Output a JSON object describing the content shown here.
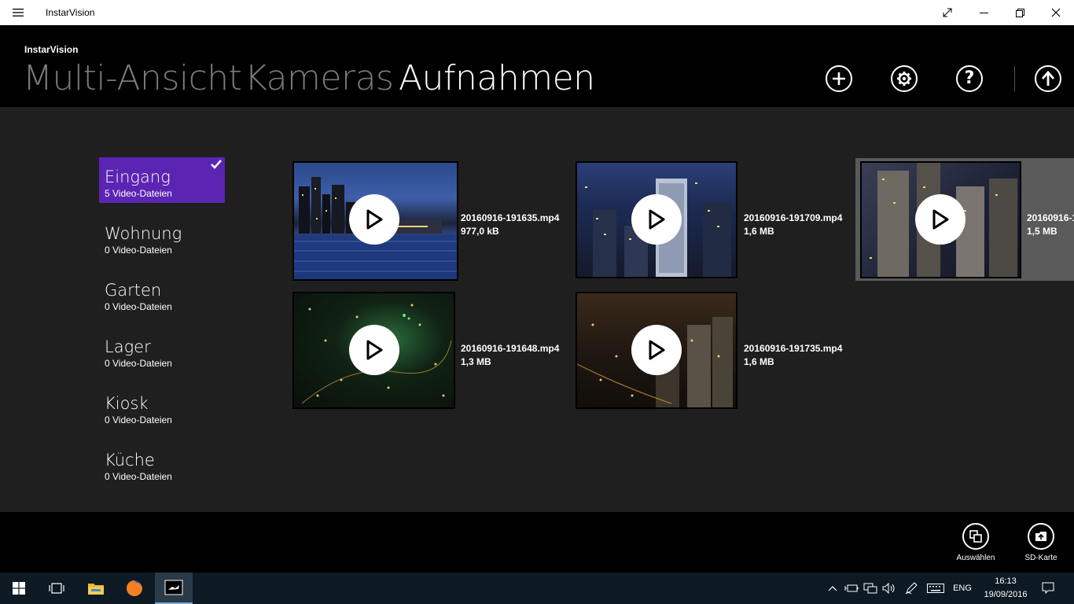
{
  "window": {
    "title": "InstarVision"
  },
  "header": {
    "brand": "InstarVision",
    "tabs": [
      {
        "label": "Multi-Ansicht",
        "active": false
      },
      {
        "label": "Kameras",
        "active": false
      },
      {
        "label": "Aufnahmen",
        "active": true
      }
    ]
  },
  "cameras": [
    {
      "name": "Eingang",
      "count": "5 Video-Dateien",
      "selected": true
    },
    {
      "name": "Wohnung",
      "count": "0 Video-Dateien"
    },
    {
      "name": "Garten",
      "count": "0 Video-Dateien"
    },
    {
      "name": "Lager",
      "count": "0 Video-Dateien"
    },
    {
      "name": "Kiosk",
      "count": "0 Video-Dateien"
    },
    {
      "name": "Küche",
      "count": "0 Video-Dateien"
    }
  ],
  "recordings": [
    {
      "file": "20160916-191635.mp4",
      "size": "977,0 kB"
    },
    {
      "file": "20160916-191648.mp4",
      "size": "1,3 MB"
    },
    {
      "file": "20160916-191709.mp4",
      "size": "1,6 MB"
    },
    {
      "file": "20160916-191735.mp4",
      "size": "1,6 MB"
    },
    {
      "file": "20160916-1",
      "size": "1,5 MB"
    }
  ],
  "appbar": {
    "select_label": "Auswählen",
    "sd_label": "SD-Karte"
  },
  "taskbar": {
    "language": "ENG",
    "time": "16:13",
    "date": "19/09/2016"
  },
  "colors": {
    "accent": "#5b24b3",
    "header_bg": "#000000",
    "content_bg": "#1f1f1f",
    "inactive_tab": "#7a7a7a"
  },
  "icons": [
    "hamburger-icon",
    "expand-icon",
    "minimize-icon",
    "maximize-icon",
    "close-icon",
    "add-icon",
    "settings-icon",
    "help-icon",
    "upload-icon",
    "play-icon",
    "checkmark-icon",
    "select-icon",
    "sd-card-icon",
    "windows-icon",
    "task-view-icon",
    "file-explorer-icon",
    "firefox-icon",
    "instarvision-icon",
    "notification-icon"
  ]
}
